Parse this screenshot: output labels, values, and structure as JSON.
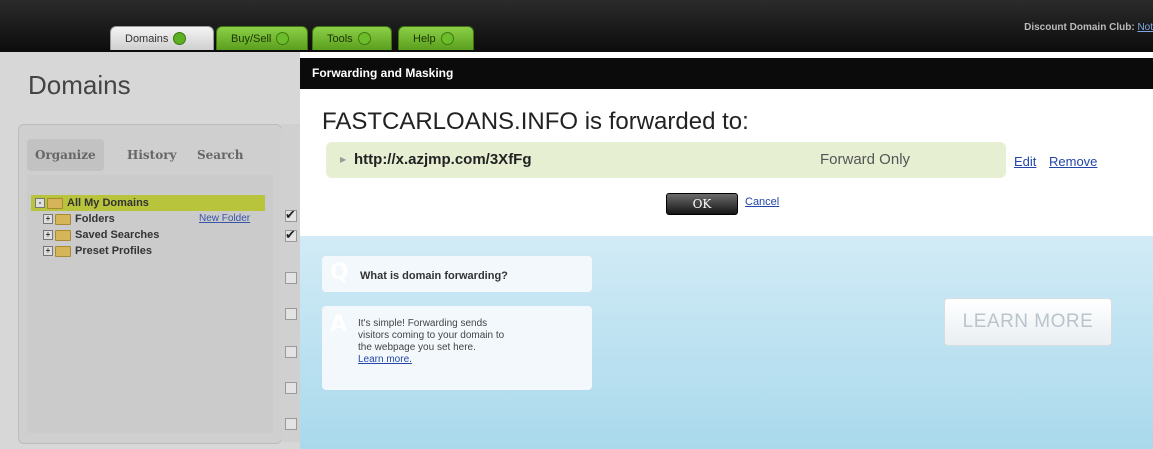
{
  "nav": {
    "tabs": [
      {
        "label": "Domains",
        "active": true
      },
      {
        "label": "Buy/Sell",
        "active": false
      },
      {
        "label": "Tools",
        "active": false
      },
      {
        "label": "Help",
        "active": false
      }
    ],
    "discount_label": "Discount Domain Club:",
    "discount_link": "Not"
  },
  "sidebar": {
    "page_title": "Domains",
    "tabs": [
      "Organize",
      "History",
      "Search"
    ],
    "tree": [
      {
        "label": "All My Domains",
        "selected": true
      },
      {
        "label": "Folders",
        "action": "New Folder"
      },
      {
        "label": "Saved Searches"
      },
      {
        "label": "Preset Profiles"
      }
    ]
  },
  "modal": {
    "header": "Forwarding and Masking",
    "title": "FASTCARLOANS.INFO is forwarded to:",
    "forward": {
      "url": "http://x.azjmp.com/3XfFg",
      "type": "Forward Only",
      "edit_label": "Edit",
      "remove_label": "Remove"
    },
    "ok_label": "OK",
    "cancel_label": "Cancel"
  },
  "help": {
    "q_icon": "Q",
    "question": "What is domain forwarding?",
    "a_icon": "A",
    "answer_lines": [
      "It's simple! Forwarding sends",
      "visitors coming to your domain to",
      "the webpage you set here."
    ],
    "learn_link": "Learn more.",
    "learn_more_button": "LEARN MORE"
  },
  "colors": {
    "accent_green": "#6cbd2a",
    "link_blue": "#2346a8",
    "forward_row_bg": "#e7efd3"
  }
}
